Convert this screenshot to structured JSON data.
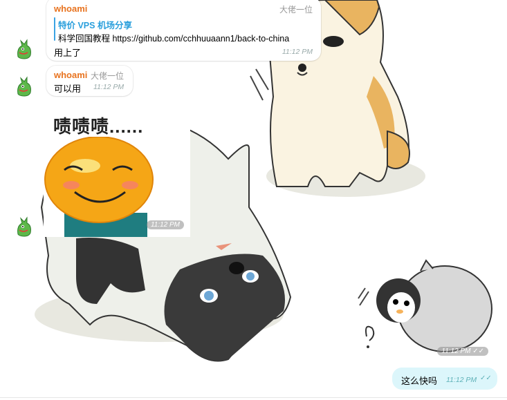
{
  "messages": [
    {
      "sender": "whoami",
      "role": "大佬一位",
      "reply_title": "特价 VPS 机场分享",
      "reply_text": "科学回国教程 https://github.com/cchhuuaann1/back-to-china",
      "text": "用上了",
      "time": "11:12 PM"
    },
    {
      "sender": "whoami",
      "role": "大佬一位",
      "text": "可以用",
      "time": "11:12 PM"
    },
    {
      "type": "sticker",
      "caption": "啧啧啧......",
      "time": "11:12 PM"
    },
    {
      "type": "sticker",
      "time": "11:12 PM",
      "status_icon": "double-check-icon"
    },
    {
      "text": "这么快吗",
      "time": "11:12 PM",
      "status_icon": "double-check-icon"
    }
  ],
  "colors": {
    "sender": "#e8731f",
    "reply_accent": "#2a9fdc",
    "outgoing_bubble": "#dcf6fb",
    "time": "#9aa"
  }
}
